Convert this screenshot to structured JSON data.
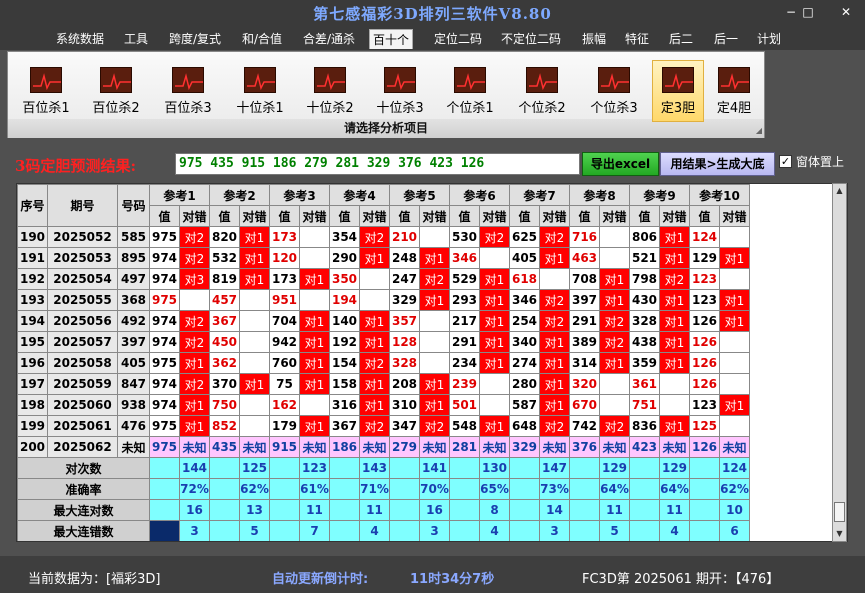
{
  "window": {
    "title": "第七感福彩3D排列三软件V8.80",
    "min": "−",
    "max": "□",
    "close": "✕"
  },
  "menu": [
    "系统数据",
    "工具",
    "跨度/复式",
    "和/合值",
    "合差/通杀",
    "百十个",
    "定位二码",
    "不定位二码",
    "振幅",
    "特征",
    "后二",
    "后一",
    "计划"
  ],
  "menu_active": "百十个",
  "ribbon": {
    "buttons": [
      "百位杀1",
      "百位杀2",
      "百位杀3",
      "十位杀1",
      "十位杀2",
      "十位杀3",
      "个位杀1",
      "个位杀2",
      "个位杀3",
      "定3胆",
      "定4胆"
    ],
    "active": "定3胆",
    "caption": "请选择分析项目"
  },
  "result": {
    "label": "3码定胆预测结果:",
    "value": "975 435 915 186 279 281 329 376 423 126",
    "excel_btn": "导出excel",
    "gen_btn": "用结果>生成大底",
    "checkbox_checked": true,
    "checkbox_label": "窗体置上"
  },
  "table": {
    "headers": {
      "seq": "序号",
      "period": "期号",
      "code": "号码",
      "val": "值",
      "hit": "对错"
    },
    "groups": [
      "参考1",
      "参考2",
      "参考3",
      "参考4",
      "参考5",
      "参考6",
      "参考7",
      "参考8",
      "参考9",
      "参考10"
    ],
    "rows": [
      {
        "seq": "190",
        "period": "2025052",
        "code": "585",
        "cells": [
          [
            "975",
            false,
            "对2"
          ],
          [
            "820",
            false,
            "对1"
          ],
          [
            "173",
            true,
            ""
          ],
          [
            "354",
            false,
            "对2"
          ],
          [
            "210",
            true,
            ""
          ],
          [
            "530",
            false,
            "对2"
          ],
          [
            "625",
            false,
            "对2"
          ],
          [
            "716",
            true,
            ""
          ],
          [
            "806",
            false,
            "对1"
          ],
          [
            "124",
            true,
            ""
          ]
        ]
      },
      {
        "seq": "191",
        "period": "2025053",
        "code": "895",
        "cells": [
          [
            "974",
            false,
            "对2"
          ],
          [
            "532",
            false,
            "对1"
          ],
          [
            "120",
            true,
            ""
          ],
          [
            "290",
            false,
            "对1"
          ],
          [
            "248",
            false,
            "对1"
          ],
          [
            "346",
            true,
            ""
          ],
          [
            "405",
            false,
            "对1"
          ],
          [
            "463",
            true,
            ""
          ],
          [
            "521",
            false,
            "对1"
          ],
          [
            "129",
            false,
            "对1"
          ]
        ]
      },
      {
        "seq": "192",
        "period": "2025054",
        "code": "497",
        "cells": [
          [
            "974",
            false,
            "对3"
          ],
          [
            "819",
            false,
            "对1"
          ],
          [
            "173",
            false,
            "对1"
          ],
          [
            "350",
            true,
            ""
          ],
          [
            "247",
            false,
            "对2"
          ],
          [
            "529",
            false,
            "对1"
          ],
          [
            "618",
            true,
            ""
          ],
          [
            "708",
            false,
            "对1"
          ],
          [
            "798",
            false,
            "对2"
          ],
          [
            "123",
            true,
            ""
          ]
        ]
      },
      {
        "seq": "193",
        "period": "2025055",
        "code": "368",
        "cells": [
          [
            "975",
            true,
            ""
          ],
          [
            "457",
            true,
            ""
          ],
          [
            "951",
            true,
            ""
          ],
          [
            "194",
            true,
            ""
          ],
          [
            "329",
            false,
            "对1"
          ],
          [
            "293",
            false,
            "对1"
          ],
          [
            "346",
            false,
            "对2"
          ],
          [
            "397",
            false,
            "对1"
          ],
          [
            "430",
            false,
            "对1"
          ],
          [
            "123",
            false,
            "对1"
          ]
        ]
      },
      {
        "seq": "194",
        "period": "2025056",
        "code": "492",
        "cells": [
          [
            "974",
            false,
            "对2"
          ],
          [
            "367",
            true,
            ""
          ],
          [
            "704",
            false,
            "对1"
          ],
          [
            "140",
            false,
            "对1"
          ],
          [
            "357",
            true,
            ""
          ],
          [
            "217",
            false,
            "对1"
          ],
          [
            "254",
            false,
            "对2"
          ],
          [
            "291",
            false,
            "对2"
          ],
          [
            "328",
            false,
            "对1"
          ],
          [
            "126",
            false,
            "对1"
          ]
        ]
      },
      {
        "seq": "195",
        "period": "2025057",
        "code": "397",
        "cells": [
          [
            "974",
            false,
            "对2"
          ],
          [
            "450",
            true,
            ""
          ],
          [
            "942",
            false,
            "对1"
          ],
          [
            "192",
            false,
            "对1"
          ],
          [
            "128",
            true,
            ""
          ],
          [
            "291",
            false,
            "对1"
          ],
          [
            "340",
            false,
            "对1"
          ],
          [
            "389",
            false,
            "对2"
          ],
          [
            "438",
            false,
            "对1"
          ],
          [
            "126",
            true,
            ""
          ]
        ]
      },
      {
        "seq": "196",
        "period": "2025058",
        "code": "405",
        "cells": [
          [
            "975",
            false,
            "对1"
          ],
          [
            "362",
            true,
            ""
          ],
          [
            "760",
            false,
            "对1"
          ],
          [
            "154",
            false,
            "对2"
          ],
          [
            "328",
            true,
            ""
          ],
          [
            "234",
            false,
            "对1"
          ],
          [
            "274",
            false,
            "对1"
          ],
          [
            "314",
            false,
            "对1"
          ],
          [
            "359",
            false,
            "对1"
          ],
          [
            "126",
            true,
            ""
          ]
        ]
      },
      {
        "seq": "197",
        "period": "2025059",
        "code": "847",
        "cells": [
          [
            "974",
            false,
            "对2"
          ],
          [
            "370",
            false,
            "对1"
          ],
          [
            "75",
            false,
            "对1"
          ],
          [
            "158",
            false,
            "对1"
          ],
          [
            "208",
            false,
            "对1"
          ],
          [
            "239",
            true,
            ""
          ],
          [
            "280",
            false,
            "对1"
          ],
          [
            "320",
            true,
            ""
          ],
          [
            "361",
            true,
            ""
          ],
          [
            "126",
            true,
            ""
          ]
        ]
      },
      {
        "seq": "198",
        "period": "2025060",
        "code": "938",
        "cells": [
          [
            "974",
            false,
            "对1"
          ],
          [
            "750",
            true,
            ""
          ],
          [
            "162",
            true,
            ""
          ],
          [
            "316",
            false,
            "对1"
          ],
          [
            "310",
            false,
            "对1"
          ],
          [
            "501",
            true,
            ""
          ],
          [
            "587",
            false,
            "对1"
          ],
          [
            "670",
            true,
            ""
          ],
          [
            "751",
            true,
            ""
          ],
          [
            "123",
            false,
            "对1"
          ]
        ]
      },
      {
        "seq": "199",
        "period": "2025061",
        "code": "476",
        "cells": [
          [
            "975",
            false,
            "对1"
          ],
          [
            "852",
            true,
            ""
          ],
          [
            "179",
            false,
            "对1"
          ],
          [
            "367",
            false,
            "对2"
          ],
          [
            "347",
            false,
            "对2"
          ],
          [
            "548",
            false,
            "对1"
          ],
          [
            "648",
            false,
            "对2"
          ],
          [
            "742",
            false,
            "对2"
          ],
          [
            "836",
            false,
            "对1"
          ],
          [
            "125",
            true,
            ""
          ]
        ]
      }
    ],
    "future": {
      "seq": "200",
      "period": "2025062",
      "code": "未知",
      "vals": [
        "975",
        "435",
        "915",
        "186",
        "279",
        "281",
        "329",
        "376",
        "423",
        "126"
      ],
      "hit": "未知"
    },
    "stats": [
      {
        "label": "对次数",
        "vals": [
          "144",
          "125",
          "123",
          "143",
          "141",
          "130",
          "147",
          "129",
          "129",
          "124"
        ]
      },
      {
        "label": "准确率",
        "vals": [
          "72%",
          "62%",
          "61%",
          "71%",
          "70%",
          "65%",
          "73%",
          "64%",
          "64%",
          "62%"
        ]
      },
      {
        "label": "最大连对数",
        "vals": [
          "16",
          "13",
          "11",
          "11",
          "16",
          "8",
          "14",
          "11",
          "11",
          "10"
        ]
      },
      {
        "label": "最大连错数",
        "vals": [
          "3",
          "5",
          "7",
          "4",
          "3",
          "4",
          "3",
          "5",
          "4",
          "6"
        ]
      }
    ]
  },
  "status": {
    "left": "当前数据为：[福彩3D]",
    "mid_label": "自动更新倒计时:",
    "mid_value": "11时34分7秒",
    "right": "FC3D第 2025061 期开：【476】"
  },
  "colors": {
    "hit": "#ff0000",
    "future": "#ffc6ff",
    "stat": "#7fffff",
    "navy": "#0a2a6a"
  }
}
